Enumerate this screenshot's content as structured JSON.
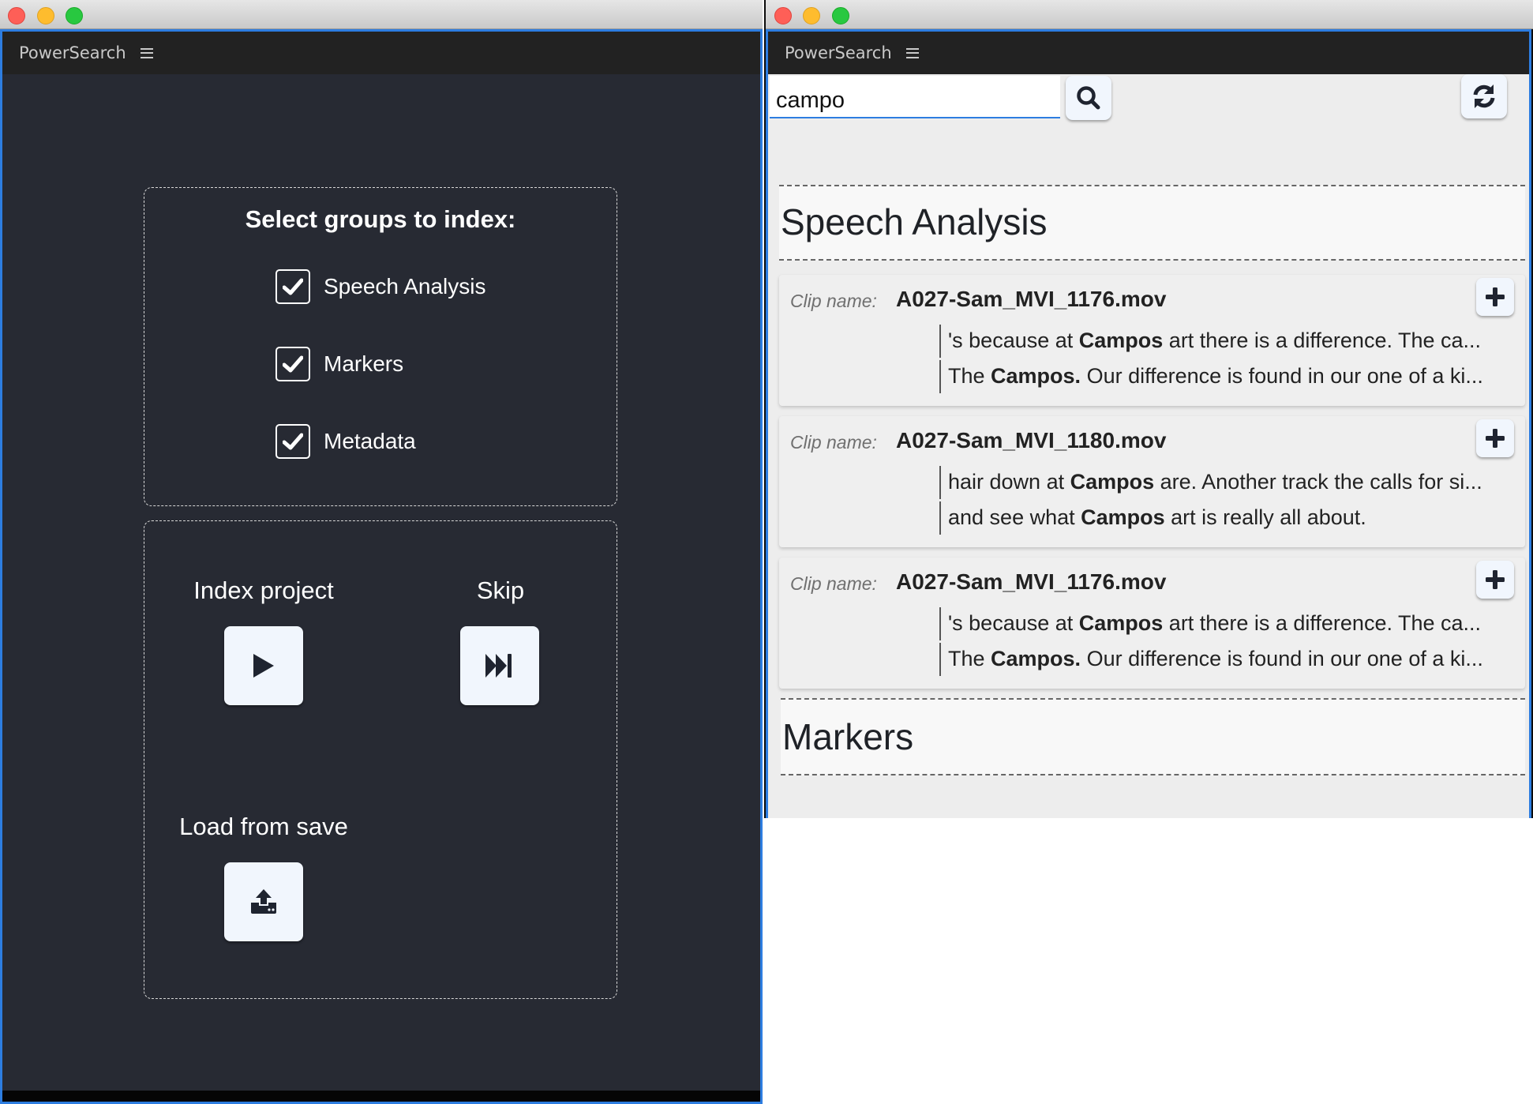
{
  "left_window": {
    "app_title": "PowerSearch",
    "menu_icon": "hamburger-icon",
    "groups": {
      "heading": "Select groups to index:",
      "items": [
        {
          "label": "Speech Analysis",
          "checked": true
        },
        {
          "label": "Markers",
          "checked": true
        },
        {
          "label": "Metadata",
          "checked": true
        }
      ]
    },
    "actions": {
      "index_label": "Index project",
      "index_icon": "play-icon",
      "skip_label": "Skip",
      "skip_icon": "skip-forward-icon",
      "load_label": "Load from save",
      "load_icon": "upload-icon"
    }
  },
  "right_window": {
    "app_title": "PowerSearch",
    "menu_icon": "hamburger-icon",
    "search": {
      "value": "campo",
      "search_icon": "search-icon",
      "refresh_icon": "refresh-icon"
    },
    "sections": [
      {
        "title": "Speech Analysis",
        "results": [
          {
            "clip_label": "Clip name:",
            "clip_name": "A027-Sam_MVI_1176.mov",
            "snippets": [
              {
                "before": "'s because at ",
                "match": "Campos",
                "after": " art there is a difference. The ca..."
              },
              {
                "before": "The ",
                "match": "Campos.",
                "after": " Our difference is found in our one of a ki..."
              }
            ]
          },
          {
            "clip_label": "Clip name:",
            "clip_name": "A027-Sam_MVI_1180.mov",
            "snippets": [
              {
                "before": "hair down at ",
                "match": "Campos",
                "after": " are. Another track the calls for si..."
              },
              {
                "before": "and see what ",
                "match": "Campos",
                "after": " art is really all about."
              }
            ]
          },
          {
            "clip_label": "Clip name:",
            "clip_name": "A027-Sam_MVI_1176.mov",
            "snippets": [
              {
                "before": "'s because at ",
                "match": "Campos",
                "after": " art there is a difference. The ca..."
              },
              {
                "before": "The ",
                "match": "Campos.",
                "after": " Our difference is found in our one of a ki..."
              }
            ]
          }
        ]
      },
      {
        "title": "Markers",
        "results": []
      }
    ]
  },
  "colors": {
    "accent": "#2d7de0",
    "dark_bg": "#272a33",
    "header_bg": "#222222",
    "light_bg": "#ededed",
    "button_bg": "#f1f6fd"
  }
}
